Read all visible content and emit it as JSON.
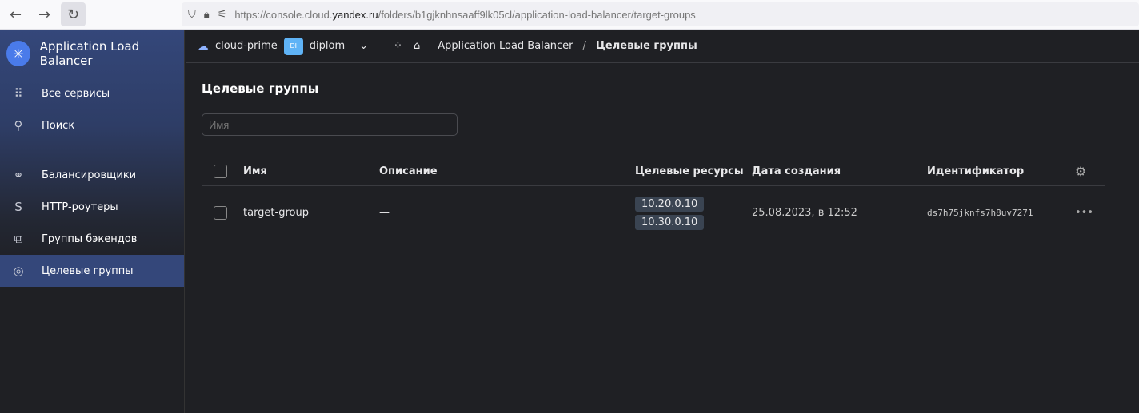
{
  "browser": {
    "url_prefix": "https://console.cloud.",
    "url_domain": "yandex.ru",
    "url_suffix": "/folders/b1gjknhnsaaff9lk05cl/application-load-balancer/target-groups"
  },
  "sidebar": {
    "service": "Application Load Balancer",
    "items": [
      {
        "label": "Все сервисы",
        "icon": "grid-icon"
      },
      {
        "label": "Поиск",
        "icon": "search-icon"
      },
      {
        "label": "Балансировщики",
        "icon": "hierarchy-icon"
      },
      {
        "label": "HTTP-роутеры",
        "icon": "route-icon"
      },
      {
        "label": "Группы бэкендов",
        "icon": "cubes-icon"
      },
      {
        "label": "Целевые группы",
        "icon": "target-icon",
        "active": true
      }
    ]
  },
  "topbar": {
    "cloud": "cloud-prime",
    "folder_badge": "DI",
    "folder": "diplom",
    "breadcrumb": [
      "Application Load Balancer",
      "Целевые группы"
    ],
    "separator": "/"
  },
  "page": {
    "title": "Целевые группы",
    "search_placeholder": "Имя"
  },
  "table": {
    "columns": [
      "Имя",
      "Описание",
      "Целевые ресурсы",
      "Дата создания",
      "Идентификатор"
    ],
    "rows": [
      {
        "name": "target-group",
        "description": "—",
        "resources": [
          "10.20.0.10",
          "10.30.0.10"
        ],
        "created": "25.08.2023, в 12:52",
        "id": "ds7h75jknfs7h8uv7271"
      }
    ]
  }
}
